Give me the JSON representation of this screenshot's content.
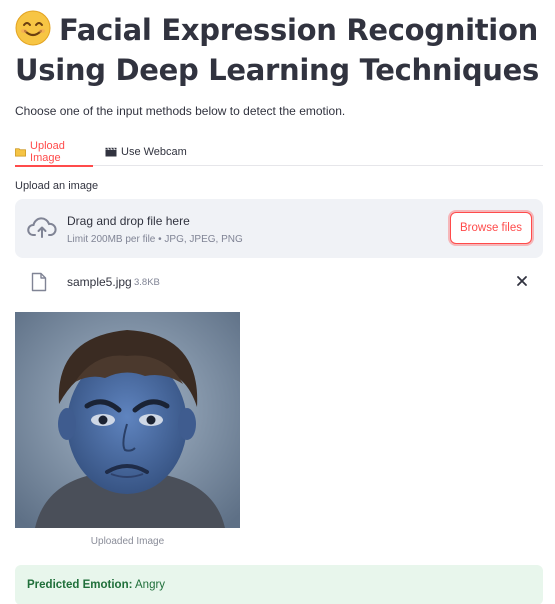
{
  "header": {
    "emoji": "😊",
    "title": "Facial Expression Recognition Using Deep Learning Techniques",
    "subtitle": "Choose one of the input methods below to detect the emotion."
  },
  "tabs": [
    {
      "icon": "folder-icon",
      "label": "Upload Image",
      "active": true
    },
    {
      "icon": "clapperboard-icon",
      "label": "Use Webcam",
      "active": false
    }
  ],
  "uploader": {
    "label": "Upload an image",
    "drop_text": "Drag and drop file here",
    "limit_text": "Limit 200MB per file • JPG, JPEG, PNG",
    "browse_label": "Browse files"
  },
  "file": {
    "name": "sample5.jpg",
    "size": "3.8KB"
  },
  "image": {
    "caption": "Uploaded Image"
  },
  "result": {
    "label": "Predicted Emotion:",
    "value": "Angry"
  },
  "colors": {
    "accent": "#ff4b4b",
    "success_bg": "#e8f6ec",
    "success_text": "#1f6f3a",
    "dropzone_bg": "#f0f2f6"
  }
}
